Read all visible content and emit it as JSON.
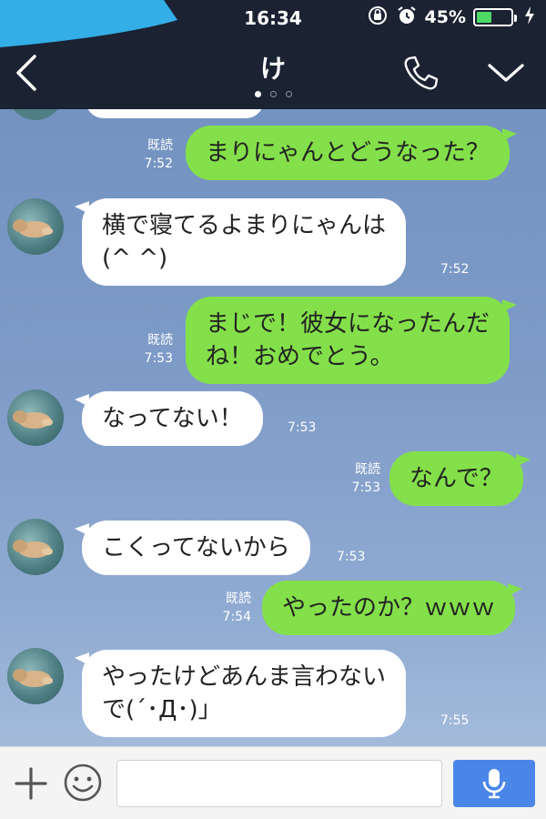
{
  "status_bar": {
    "time": "16:34",
    "battery_text": "45%",
    "battery_level": 0.45,
    "icons": [
      "orientation-lock-icon",
      "alarm-icon",
      "battery-icon",
      "charging-icon"
    ]
  },
  "nav": {
    "title": "け",
    "page_count": 3,
    "active_page": 1,
    "icons": [
      "back-chevron-icon",
      "phone-icon",
      "chevron-down-icon"
    ]
  },
  "messages": [
    {
      "direction": "out",
      "lines": [
        "まりにゃんとどうなった？"
      ],
      "read": "既読",
      "time": "7:52"
    },
    {
      "direction": "in",
      "lines": [
        "横で寝てるよまりにゃんは",
        "(^ ^)"
      ],
      "time": "7:52"
    },
    {
      "direction": "out",
      "lines": [
        "まじで！彼女になったんだ",
        "ね！おめでとう。"
      ],
      "read": "既読",
      "time": "7:53"
    },
    {
      "direction": "in",
      "lines": [
        "なってない！"
      ],
      "time": "7:53"
    },
    {
      "direction": "out",
      "lines": [
        "なんで？"
      ],
      "read": "既読",
      "time": "7:53"
    },
    {
      "direction": "in",
      "lines": [
        "こくってないから"
      ],
      "time": "7:53"
    },
    {
      "direction": "out",
      "lines": [
        "やったのか？ｗｗｗ"
      ],
      "read": "既読",
      "time": "7:54"
    },
    {
      "direction": "in",
      "lines": [
        "やったけどあんま言わない",
        "で(´･Д･)」"
      ],
      "time": "7:55"
    }
  ],
  "footer": {
    "input_value": "",
    "input_placeholder": "",
    "icons": [
      "plus-icon",
      "emoji-icon",
      "microphone-icon"
    ],
    "mic_color": "#4a86e8"
  },
  "colors": {
    "header_bg": "#1b2232",
    "outgoing_bubble": "#84e04a",
    "incoming_bubble": "#ffffff",
    "battery_fill": "#4cd964"
  }
}
